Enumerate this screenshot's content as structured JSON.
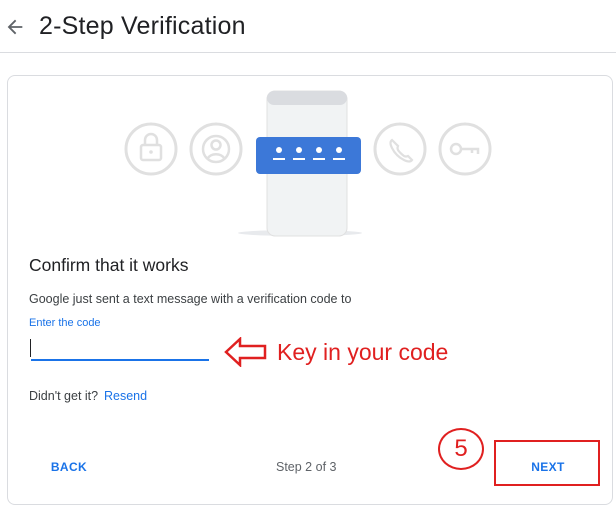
{
  "header": {
    "title": "2-Step Verification",
    "back_icon": "arrow-left-icon"
  },
  "illustration": {
    "icons": [
      "lock-icon",
      "account-circle-icon",
      "password-dots-icon",
      "phone-call-icon",
      "key-icon"
    ],
    "accent_color": "#3c78d8"
  },
  "content": {
    "title": "Confirm that it works",
    "info": "Google just sent a text message with a verification code to",
    "code_label": "Enter the code",
    "code_value": "",
    "didnt_get": "Didn't get it?",
    "resend": "Resend"
  },
  "annotation": {
    "instruction": "Key in your code",
    "step_badge": "5",
    "color": "#e02020"
  },
  "footer": {
    "back_label": "BACK",
    "step_text": "Step 2 of 3",
    "next_label": "NEXT"
  },
  "colors": {
    "link_blue": "#1a73e8",
    "annotation_red": "#e02020"
  }
}
